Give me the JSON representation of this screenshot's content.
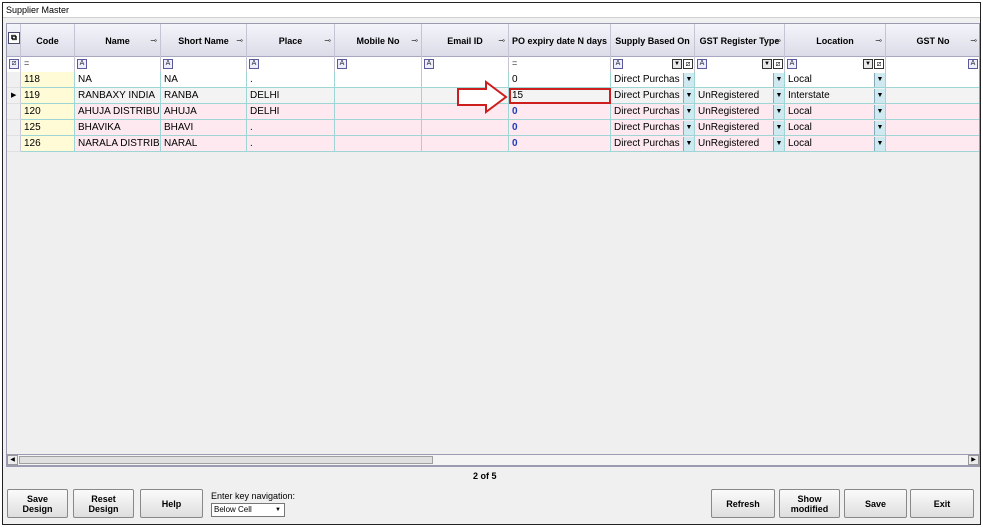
{
  "window": {
    "title": "Supplier Master"
  },
  "columns": [
    {
      "label": "Code"
    },
    {
      "label": "Name"
    },
    {
      "label": "Short Name"
    },
    {
      "label": "Place"
    },
    {
      "label": "Mobile No"
    },
    {
      "label": "Email ID"
    },
    {
      "label": "PO expiry date N days"
    },
    {
      "label": "Supply Based On"
    },
    {
      "label": "GST Register Type"
    },
    {
      "label": "Location"
    },
    {
      "label": "GST No"
    }
  ],
  "filter": {
    "equals": "="
  },
  "rows": [
    {
      "code": "118",
      "name": "NA",
      "short": "NA",
      "place": ".",
      "mobile": "",
      "email": "",
      "po": "0",
      "supply": "Direct Purchas",
      "gst_type": "",
      "location": "Local",
      "gst_no": ""
    },
    {
      "code": "119",
      "name": "RANBAXY INDIA",
      "short": "RANBA",
      "place": "DELHI",
      "mobile": "",
      "email": "",
      "po": "15",
      "supply": "Direct Purchas",
      "gst_type": "UnRegistered",
      "location": "Interstate",
      "gst_no": ""
    },
    {
      "code": "120",
      "name": "AHUJA DISTRIBU",
      "short": "AHUJA",
      "place": "DELHI",
      "mobile": "",
      "email": "",
      "po": "0",
      "supply": "Direct Purchas",
      "gst_type": "UnRegistered",
      "location": "Local",
      "gst_no": ""
    },
    {
      "code": "125",
      "name": "BHAVIKA",
      "short": "BHAVI",
      "place": ".",
      "mobile": "",
      "email": "",
      "po": "0",
      "supply": "Direct Purchas",
      "gst_type": "UnRegistered",
      "location": "Local",
      "gst_no": ""
    },
    {
      "code": "126",
      "name": "NARALA DISTRIB",
      "short": "NARAL",
      "place": ".",
      "mobile": "",
      "email": "",
      "po": "0",
      "supply": "Direct Purchas",
      "gst_type": "UnRegistered",
      "location": "Local",
      "gst_no": ""
    }
  ],
  "pager": {
    "text": "2 of 5"
  },
  "buttons": {
    "save_design": "Save\nDesign",
    "reset_design": "Reset\nDesign",
    "help": "Help",
    "refresh": "Refresh",
    "show_modified": "Show\nmodified",
    "save": "Save",
    "exit": "Exit"
  },
  "nav": {
    "label": "Enter key navigation:",
    "selected": "Below Cell"
  },
  "icons": {
    "pin": "pin-icon",
    "filter": "filter-text-icon",
    "clear_filter": "clear-filter-icon",
    "dropdown": "chevron-down-icon",
    "row_pointer": "row-pointer-icon",
    "annotation": "red-arrow-icon"
  },
  "colors": {
    "highlight": "#cc1e1e",
    "zero_value": "#1b3dbb"
  }
}
